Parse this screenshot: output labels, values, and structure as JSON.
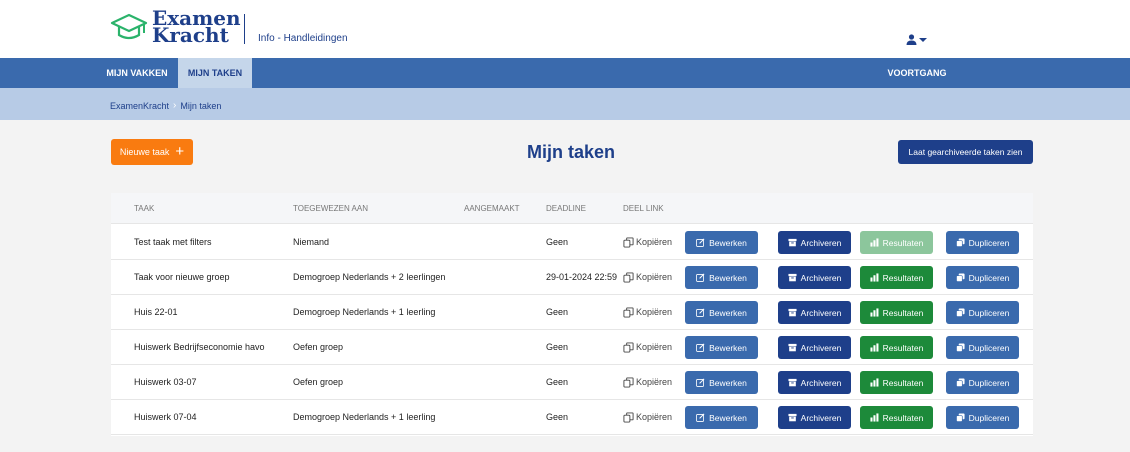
{
  "header": {
    "logo_line1": "Examen",
    "logo_line2": "Kracht",
    "info_link": "Info - Handleidingen"
  },
  "nav": {
    "tab_vakken": "MIJN VAKKEN",
    "tab_taken": "MIJN TAKEN",
    "tab_voortgang": "VOORTGANG"
  },
  "breadcrumb": {
    "home": "ExamenKracht",
    "separator": "›",
    "current": "Mijn taken"
  },
  "page": {
    "new_task_label": "Nieuwe taak",
    "title": "Mijn taken",
    "archived_label": "Laat gearchiveerde taken zien"
  },
  "colors": {
    "brand_blue": "#1e3f8a",
    "nav_blue": "#3a6aad",
    "orange": "#f97b10",
    "green": "#1d8a3a"
  },
  "table": {
    "headers": {
      "taak": "TAAK",
      "toegewezen": "TOEGEWEZEN AAN",
      "aangemaakt": "AANGEMAAKT",
      "deadline": "DEADLINE",
      "deel_link": "DEEL LINK"
    },
    "copy_label": "Kopiëren",
    "actions": {
      "edit": "Bewerken",
      "archive": "Archiveren",
      "results": "Resultaten",
      "duplicate": "Dupliceren"
    },
    "rows": [
      {
        "taak": "Test taak met filters",
        "toegewezen": "Niemand",
        "aangemaakt": "",
        "deadline": "Geen",
        "results_enabled": false
      },
      {
        "taak": "Taak voor nieuwe groep",
        "toegewezen": "Demogroep Nederlands + 2 leerlingen",
        "aangemaakt": "",
        "deadline": "29-01-2024 22:59",
        "results_enabled": true
      },
      {
        "taak": "Huis 22-01",
        "toegewezen": "Demogroep Nederlands + 1 leerling",
        "aangemaakt": "",
        "deadline": "Geen",
        "results_enabled": true
      },
      {
        "taak": "Huiswerk Bedrijfseconomie havo",
        "toegewezen": "Oefen groep",
        "aangemaakt": "",
        "deadline": "Geen",
        "results_enabled": true
      },
      {
        "taak": "Huiswerk 03-07",
        "toegewezen": "Oefen groep",
        "aangemaakt": "",
        "deadline": "Geen",
        "results_enabled": true
      },
      {
        "taak": "Huiswerk 07-04",
        "toegewezen": "Demogroep Nederlands + 1 leerling",
        "aangemaakt": "",
        "deadline": "Geen",
        "results_enabled": true
      }
    ]
  }
}
